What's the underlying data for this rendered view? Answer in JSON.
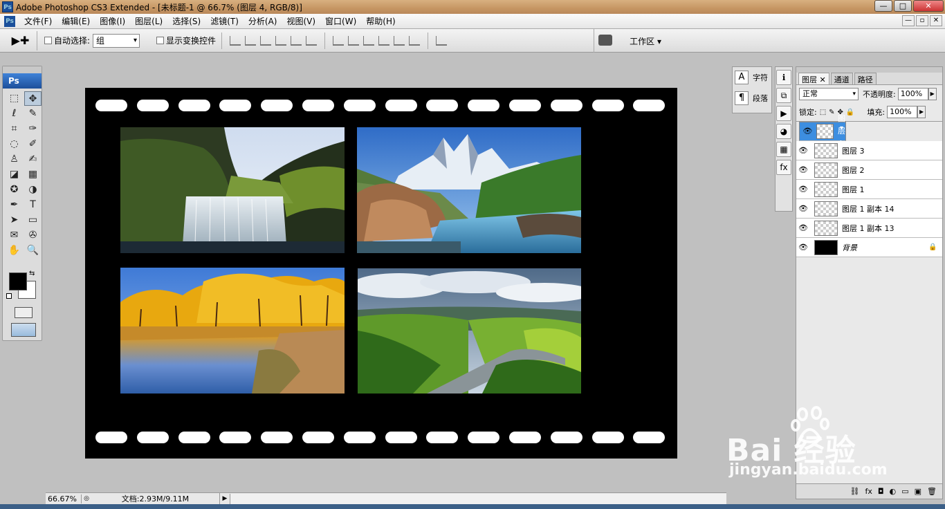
{
  "window": {
    "title": "Adobe Photoshop CS3 Extended - [未标题-1 @ 66.7% (图层 4, RGB/8)]",
    "app_icon": "Ps",
    "controls": {
      "minimize": "—",
      "maximize": "□",
      "close": "✕"
    }
  },
  "menu": {
    "items": [
      "文件(F)",
      "编辑(E)",
      "图像(I)",
      "图层(L)",
      "选择(S)",
      "滤镜(T)",
      "分析(A)",
      "视图(V)",
      "窗口(W)",
      "帮助(H)"
    ],
    "mdi": {
      "minimize": "—",
      "restore": "▫",
      "close": "✕"
    }
  },
  "options": {
    "tool_icon": "▶✚",
    "auto_select_label": "自动选择:",
    "auto_select_value": "组",
    "show_transform_label": "显示变换控件",
    "workspace_label": "工作区 ▾"
  },
  "toolbox": {
    "logo": "Ps",
    "tools": [
      "⬚",
      "✥",
      "ℓ",
      "✎",
      "⌗",
      "✑",
      "◌",
      "✐",
      "♙",
      "✍",
      "◪",
      "▦",
      "✪",
      "◑",
      "✒",
      "T",
      "➤",
      "▭",
      "✉",
      "✇",
      "✋",
      "🔍"
    ],
    "foreground_color": "#000000",
    "background_color": "#ffffff"
  },
  "canvas": {
    "background_color": "#000000",
    "hole_color": "#ffffff"
  },
  "status": {
    "zoom": "66.67%",
    "doc": "文档:2.93M/9.11M"
  },
  "mini_panel": {
    "rows": [
      {
        "icon": "A",
        "label": "字符"
      },
      {
        "icon": "¶",
        "label": "段落"
      }
    ]
  },
  "icon_column": [
    "ℹ",
    "⧉",
    "▶",
    "◕",
    "▦",
    "fx"
  ],
  "layers_panel": {
    "tabs": [
      "图层",
      "通道",
      "路径"
    ],
    "tab_close": "✕",
    "blend_mode": "正常",
    "opacity_label": "不透明度:",
    "opacity_value": "100%",
    "lock_label": "锁定:",
    "fill_label": "填充:",
    "fill_value": "100%",
    "layers": [
      {
        "name": "图层 4",
        "selected": true
      },
      {
        "name": "图层 3",
        "selected": false
      },
      {
        "name": "图层 2",
        "selected": false
      },
      {
        "name": "图层 1",
        "selected": false
      },
      {
        "name": "图层 1 副本 14",
        "selected": false
      },
      {
        "name": "图层 1 副本 13",
        "selected": false
      },
      {
        "name": "背景",
        "selected": false,
        "locked": true
      }
    ],
    "footer_icons": [
      "⛓",
      "fx",
      "◘",
      "◐",
      "▭",
      "▣",
      "🗑"
    ]
  },
  "watermark": {
    "brand": "Bai  经验",
    "url": "jingyan.baidu.com"
  }
}
